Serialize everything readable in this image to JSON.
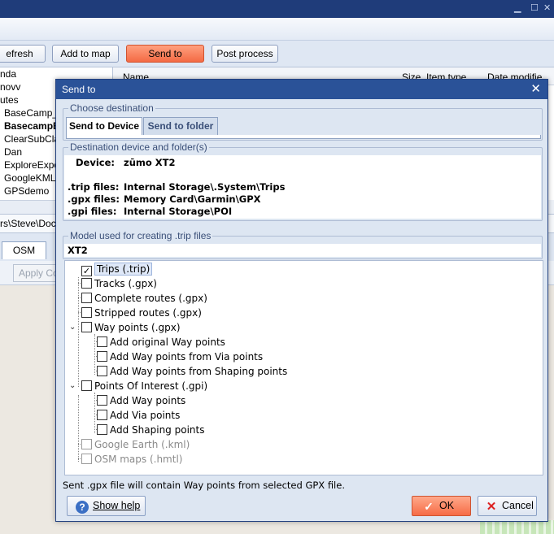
{
  "toolbar": {
    "refresh": "efresh",
    "add_to_map": "Add to map",
    "send_to": "Send to",
    "post_process": "Post process"
  },
  "left_tree": {
    "items": [
      "nda",
      "novv",
      "utes",
      "BaseCamp_B",
      "BasecampB",
      "ClearSubClas",
      "Dan",
      "ExploreExpor",
      "GoogleKML",
      "GPSdemo"
    ]
  },
  "list_header": {
    "name": "Name",
    "size": "Size",
    "item_type": "Item type",
    "date_modified": "Date modifie"
  },
  "path_bar": {
    "path": "rs\\Steve\\Docu"
  },
  "map_tabs": {
    "osm": "OSM Map",
    "apply": "Apply Co"
  },
  "dialog": {
    "title": "Send to",
    "choose_destination": {
      "label": "Choose destination",
      "tabs": [
        "Send to Device",
        "Send to folder"
      ],
      "active": "Send to Device"
    },
    "destination": {
      "label": "Destination device and folder(s)",
      "device_key": "Device:",
      "device_value": "zūmo XT2",
      "trip_key": ".trip files:",
      "trip_value": "Internal Storage\\.System\\Trips",
      "gpx_key": ".gpx files:",
      "gpx_value": "Memory Card\\Garmin\\GPX",
      "gpi_key": ".gpi files:",
      "gpi_value": "Internal Storage\\POI"
    },
    "model": {
      "label": "Model used for creating .trip files",
      "value": "XT2"
    },
    "options": [
      {
        "label": "Trips (.trip)",
        "checked": true
      },
      {
        "label": "Tracks (.gpx)",
        "checked": false
      },
      {
        "label": "Complete routes (.gpx)",
        "checked": false
      },
      {
        "label": "Stripped routes (.gpx)",
        "checked": false
      },
      {
        "label": "Way points (.gpx)",
        "checked": false
      },
      {
        "label": "Add original Way points",
        "checked": false
      },
      {
        "label": "Add Way points from Via points",
        "checked": false
      },
      {
        "label": "Add Way points from Shaping points",
        "checked": false
      },
      {
        "label": "Points Of Interest (.gpi)",
        "checked": false
      },
      {
        "label": "Add Way points",
        "checked": false
      },
      {
        "label": "Add Via points",
        "checked": false
      },
      {
        "label": "Add Shaping points",
        "checked": false
      },
      {
        "label": "Google Earth (.kml)",
        "checked": false,
        "disabled": true
      },
      {
        "label": "OSM maps (.hmtl)",
        "checked": false,
        "disabled": true
      }
    ],
    "status": "Sent .gpx file will contain Way points from selected GPX file.",
    "buttons": {
      "help": "Show help",
      "ok": "OK",
      "cancel": "Cancel"
    }
  },
  "colors": {
    "title_bar": "#2a5298",
    "accent_orange": "#f46a44",
    "dialog_bg": "#dde6f2"
  }
}
